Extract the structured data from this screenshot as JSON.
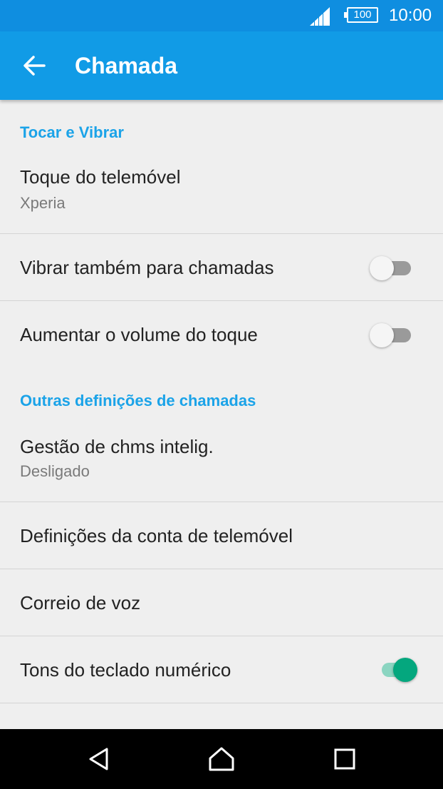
{
  "status_bar": {
    "battery": "100",
    "time": "10:00"
  },
  "app_bar": {
    "title": "Chamada"
  },
  "sections": {
    "ring": {
      "header": "Tocar e Vibrar"
    },
    "other": {
      "header": "Outras definições de chamadas"
    }
  },
  "items": [
    {
      "title": "Toque do telemóvel",
      "subtitle": "Xperia"
    },
    {
      "title": "Vibrar também para chamadas",
      "switch": false
    },
    {
      "title": "Aumentar o volume do toque",
      "switch": false
    },
    {
      "title": "Gestão de chms intelig.",
      "subtitle": "Desligado"
    },
    {
      "title": "Definições da conta de telemóvel"
    },
    {
      "title": "Correio de voz"
    },
    {
      "title": "Tons do teclado numérico",
      "switch": true
    }
  ],
  "colors": {
    "status_bar": "#0f8ee0",
    "app_bar": "#119be6",
    "section_header": "#1ba3e8",
    "switch_on": "#04a77e"
  },
  "icons": {
    "back": "arrow-left-icon",
    "signal": "signal-icon",
    "battery": "battery-icon",
    "nav_back": "triangle-back-icon",
    "nav_home": "home-icon",
    "nav_recents": "square-recents-icon"
  }
}
